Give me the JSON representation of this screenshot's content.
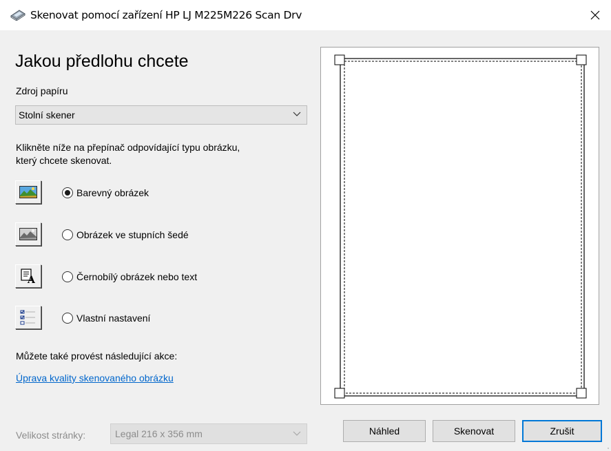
{
  "window": {
    "title": "Skenovat pomocí zařízení HP LJ M225M226 Scan Drv",
    "close_icon": "close-icon",
    "app_icon": "scanner-icon"
  },
  "main": {
    "heading": "Jakou předlohu chcete",
    "paper_source_label": "Zdroj papíru",
    "paper_source_value": "Stolní skener",
    "instructions_line1": "Klikněte níže na přepínač odpovídající typu obrázku,",
    "instructions_line2": "který chcete skenovat.",
    "options": [
      {
        "label": "Barevný obrázek",
        "selected": true,
        "icon": "color-picture-icon"
      },
      {
        "label": "Obrázek ve stupních šedé",
        "selected": false,
        "icon": "grayscale-picture-icon"
      },
      {
        "label": "Černobílý obrázek nebo text",
        "selected": false,
        "icon": "black-white-text-icon"
      },
      {
        "label": "Vlastní nastavení",
        "selected": false,
        "icon": "custom-settings-icon"
      }
    ],
    "also_label": "Můžete také provést následující akce:",
    "quality_link": "Úprava kvality skenovaného obrázku",
    "page_size_label": "Velikost stránky:",
    "page_size_value": "Legal 216 x 356 mm"
  },
  "buttons": {
    "preview": "Náhled",
    "scan": "Skenovat",
    "cancel": "Zrušit"
  },
  "colors": {
    "link": "#0066cc",
    "default_button_border": "#0078d7",
    "dialog_background": "#f0f0f0"
  }
}
